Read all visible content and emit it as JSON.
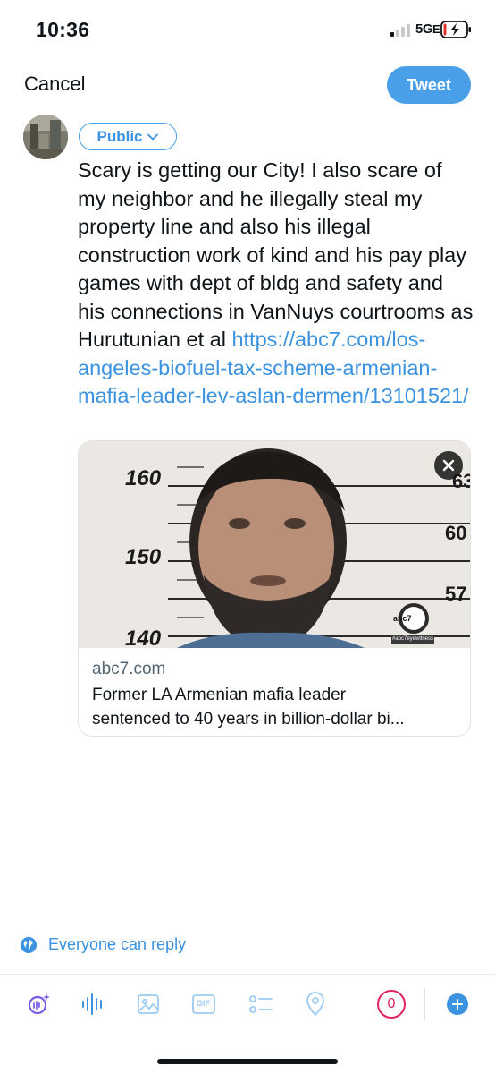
{
  "status_bar": {
    "time": "10:36",
    "network": "5G",
    "network_suffix": "E",
    "icons": [
      "signal-bars-icon",
      "battery-charging-icon"
    ]
  },
  "compose": {
    "cancel_label": "Cancel",
    "tweet_label": "Tweet",
    "audience_label": "Public",
    "text_before_link": "Scary is getting our City! I also scare of my neighbor and he illegally steal my property line and also his illegal construction work of kind and his pay play games with dept of bldg and safety and his connections in VanNuys courtrooms as Hurutunian et al ",
    "link": "https://abc7.com/los-angeles-biofuel-tax-scheme-armenian-mafia-leader-lev-aslan-dermen/13101521/"
  },
  "link_card": {
    "image_labels": {
      "height_marks": [
        "160",
        "150",
        "140"
      ],
      "right_marks": [
        "63",
        "60",
        "57"
      ],
      "logo": "abc7",
      "hashtag": "#abc7eyewitness"
    },
    "domain": "abc7.com",
    "title_line1": "Former LA Armenian mafia leader",
    "title_line2": "sentenced to 40 years in billion-dollar bi..."
  },
  "reply_setting": {
    "label": "Everyone can reply",
    "icon": "globe-icon"
  },
  "toolbar": {
    "icons": [
      "grok-sparkle-icon",
      "voice-waveform-icon",
      "image-icon",
      "gif-icon",
      "poll-icon",
      "location-icon",
      "add-thread-icon"
    ],
    "gif_label": "GIF",
    "char_counter": "0"
  },
  "colors": {
    "accent": "#3a92e0",
    "tweet_button": "#4aa0e8",
    "counter": "#e0245e",
    "muted_icon": "#9ccbf2"
  }
}
